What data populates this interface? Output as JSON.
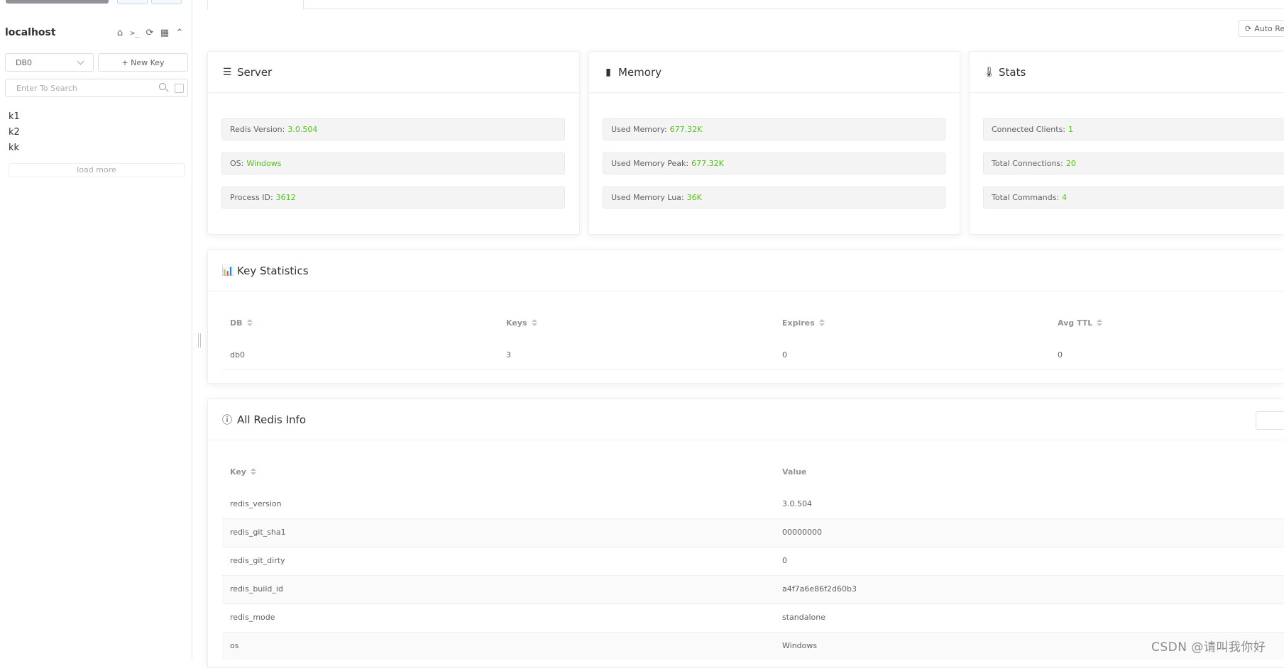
{
  "sidebar": {
    "connection_name": "localhost",
    "db_select": "DB0",
    "new_key_label": "+ New Key",
    "search_placeholder": "Enter To Search",
    "keys": [
      "k1",
      "k2",
      "kk"
    ],
    "load_more": "load more"
  },
  "toolbar": {
    "auto_refresh_label": "Auto Re"
  },
  "server": {
    "title": "Server",
    "items": [
      {
        "label": "Redis Version:",
        "value": "3.0.504"
      },
      {
        "label": "OS:",
        "value": "Windows"
      },
      {
        "label": "Process ID:",
        "value": "3612"
      }
    ]
  },
  "memory": {
    "title": "Memory",
    "items": [
      {
        "label": "Used Memory:",
        "value": "677.32K"
      },
      {
        "label": "Used Memory Peak:",
        "value": "677.32K"
      },
      {
        "label": "Used Memory Lua:",
        "value": "36K"
      }
    ]
  },
  "stats": {
    "title": "Stats",
    "items": [
      {
        "label": "Connected Clients:",
        "value": "1"
      },
      {
        "label": "Total Connections:",
        "value": "20"
      },
      {
        "label": "Total Commands:",
        "value": "4"
      }
    ]
  },
  "key_stats": {
    "title": "Key Statistics",
    "columns": [
      "DB",
      "Keys",
      "Expires",
      "Avg TTL"
    ],
    "rows": [
      [
        "db0",
        "3",
        "0",
        "0"
      ]
    ]
  },
  "all_info": {
    "title": "All Redis Info",
    "columns": [
      "Key",
      "Value"
    ],
    "rows": [
      [
        "redis_version",
        "3.0.504"
      ],
      [
        "redis_git_sha1",
        "00000000"
      ],
      [
        "redis_git_dirty",
        "0"
      ],
      [
        "redis_build_id",
        "a4f7a6e86f2d60b3"
      ],
      [
        "redis_mode",
        "standalone"
      ],
      [
        "os",
        "Windows"
      ]
    ]
  },
  "watermark": "CSDN @请叫我你好",
  "colors": {
    "value_green": "#52c41a",
    "border": "#ebeef5",
    "stripe": "#fafafa"
  }
}
